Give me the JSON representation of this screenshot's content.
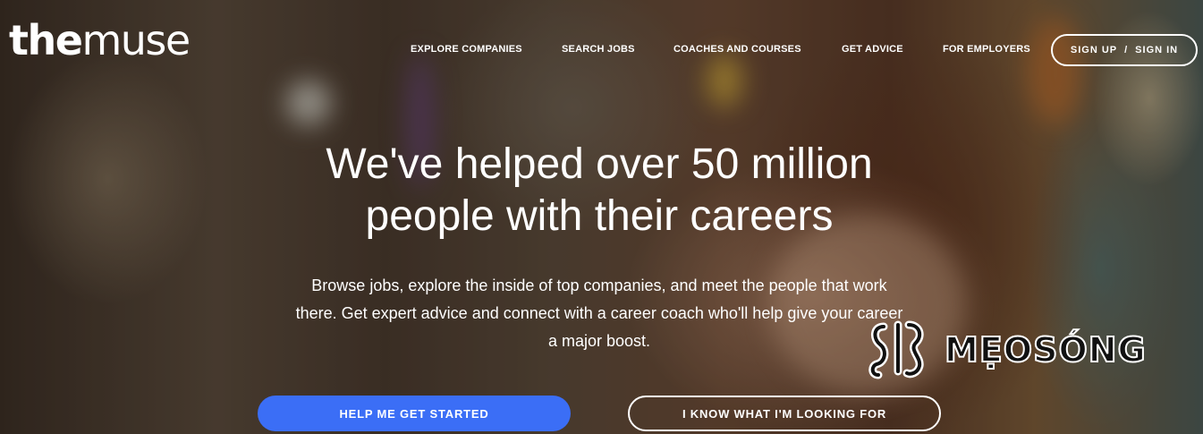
{
  "brand": {
    "logo_the": "the",
    "logo_muse": "muse"
  },
  "nav": {
    "items": [
      {
        "label": "EXPLORE COMPANIES"
      },
      {
        "label": "SEARCH JOBS"
      },
      {
        "label": "COACHES AND COURSES"
      },
      {
        "label": "GET ADVICE"
      },
      {
        "label": "FOR EMPLOYERS"
      }
    ],
    "sign_up": "SIGN UP",
    "separator": "/",
    "sign_in": "SIGN IN"
  },
  "hero": {
    "headline_line1": "We've helped over 50 million",
    "headline_line2": "people with their careers",
    "subtext_line1": "Browse jobs, explore the inside of top companies, and meet the people that work",
    "subtext_line2": "there. Get expert advice and connect with a career coach who'll help give your career",
    "subtext_line3": "a major boost.",
    "cta_primary": "HELP ME GET STARTED",
    "cta_secondary": "I KNOW WHAT I'M LOOKING FOR"
  },
  "watermark": {
    "text": "MẸOSÓNG"
  },
  "colors": {
    "primary_button": "#3b6ef6",
    "text": "#ffffff"
  }
}
